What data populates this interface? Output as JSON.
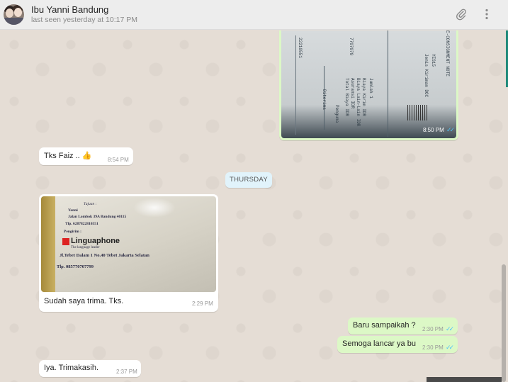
{
  "header": {
    "contact_name": "Ibu Yanni Bandung",
    "last_seen": "last seen yesterday at 10:17 PM",
    "icons": [
      "avatar",
      "paperclip-icon",
      "menu-dots-icon"
    ]
  },
  "messages": [
    {
      "type": "image-out",
      "time": "8:50 PM",
      "ticks": "✓✓",
      "image_text": [
        "E-CONSIGNMENT NOTE",
        "YES15",
        "Jenis Kiriman DOC",
        "Jumlah 1",
        "Biaya Kirim IDR",
        "Biaya Lain-Lain IDR",
        "Asuransi IDR",
        "Total Biaya IDR",
        "Penguna",
        "Diterima",
        "7707079",
        "22210551"
      ]
    },
    {
      "type": "text-in",
      "text": "Tks Faiz .. 👍",
      "time": "8:54 PM"
    },
    {
      "type": "day",
      "text": "THURSDAY"
    },
    {
      "type": "image-in",
      "caption": "Sudah saya trima. Tks.",
      "time": "2:29 PM",
      "image_text": {
        "to_label": "Tujuan :",
        "to_name": "Yanni",
        "to_address": "Jalan Lombok 39A Bandung 40115",
        "to_phone": "Tlp. 6287822810551",
        "from_label": "Pengirim :",
        "brand": "Linguaphone",
        "brand_tag": "The language leader",
        "from_address": "Jl.Tebet Dalam 1 No.40 Tebet Jakarta Selatan",
        "from_phone": "Tlp. 085770707799"
      }
    },
    {
      "type": "text-out",
      "text": "Baru sampaikah ?",
      "time": "2:30 PM",
      "ticks": "✓✓"
    },
    {
      "type": "text-out",
      "text": "Semoga lancar ya bu",
      "time": "2:30 PM",
      "ticks": "✓✓"
    },
    {
      "type": "text-in",
      "text": "Iya. Trimakasih.",
      "time": "2:37 PM"
    }
  ],
  "colors": {
    "chat_bg": "#e5ddd5",
    "incoming": "#ffffff",
    "outgoing": "#dcf8c6",
    "read_ticks": "#4fc3f7",
    "day_badge": "#e1f3fb"
  }
}
